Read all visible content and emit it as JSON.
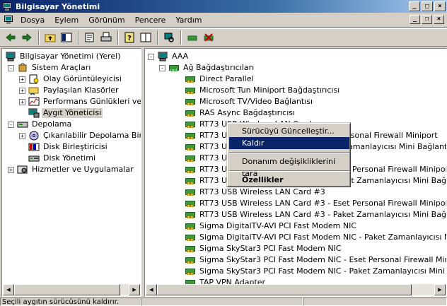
{
  "window": {
    "title": "Bilgisayar Yönetimi"
  },
  "menu": [
    "Dosya",
    "Eylem",
    "Görünüm",
    "Pencere",
    "Yardım"
  ],
  "toolbar_icons": [
    "back-arrow-icon",
    "forward-arrow-icon",
    "up-folder-icon",
    "show-tree-icon",
    "properties-icon",
    "print-icon",
    "help-icon",
    "view-icon",
    "scan-hardware-icon",
    "update-driver-icon",
    "uninstall-icon"
  ],
  "left_tree": [
    {
      "label": "Bilgisayar Yönetimi (Yerel)",
      "level": 0,
      "expander": "",
      "icon": "computer-icon"
    },
    {
      "label": "Sistem Araçları",
      "level": 1,
      "expander": "-",
      "icon": "tools-icon"
    },
    {
      "label": "Olay Görüntüleyicisi",
      "level": 2,
      "expander": "+",
      "icon": "event-viewer-icon"
    },
    {
      "label": "Paylaşılan Klasörler",
      "level": 2,
      "expander": "+",
      "icon": "shared-folder-icon"
    },
    {
      "label": "Performans Günlükleri ve Uy",
      "level": 2,
      "expander": "+",
      "icon": "performance-icon"
    },
    {
      "label": "Aygıt Yöneticisi",
      "level": 2,
      "expander": "",
      "icon": "device-manager-icon",
      "selected": true
    },
    {
      "label": "Depolama",
      "level": 1,
      "expander": "-",
      "icon": "storage-icon"
    },
    {
      "label": "Çıkarılabilir Depolama Birimi",
      "level": 2,
      "expander": "+",
      "icon": "removable-storage-icon"
    },
    {
      "label": "Disk Birleştiricisi",
      "level": 2,
      "expander": "",
      "icon": "defrag-icon"
    },
    {
      "label": "Disk Yönetimi",
      "level": 2,
      "expander": "",
      "icon": "disk-management-icon"
    },
    {
      "label": "Hizmetler ve Uygulamalar",
      "level": 1,
      "expander": "+",
      "icon": "services-icon"
    }
  ],
  "right_tree": {
    "root": "AAA",
    "category": "Ağ Bağdaştırıcıları",
    "devices": [
      "Direct Parallel",
      "Microsoft Tun Miniport Bağdaştırıcısı",
      "Microsoft TV/Video Bağlantısı",
      "RAS Async Bağdaştırıcısı",
      "RT73 USB Wireless LAN Card",
      "RT73 USB Wireless LAN Card - Eset Personal Firewall Miniport",
      "RT73 USB Wireless LAN Card - Paket Zamanlayıcısı Mini Bağlantı Noktası",
      "RT73 USB Wireless LAN Card #2",
      "RT73 USB Wireless LAN Card #2 - Eset Personal Firewall Miniport",
      "RT73 USB Wireless LAN Card #2 - Paket Zamanlayıcısı Mini Bağlantı Noktası",
      "RT73 USB Wireless LAN Card #3",
      "RT73 USB Wireless LAN Card #3 - Eset Personal Firewall Miniport",
      "RT73 USB Wireless LAN Card #3 - Paket Zamanlayıcısı Mini Bağlantı Noktası",
      "Sigma DigitalTV-AVI PCI Fast Modem NIC",
      "Sigma DigitalTV-AVI PCI Fast Modem NIC - Paket Zamanlayıcısı Mini Bağlantı Noktası",
      "Sigma SkyStar3 PCI Fast Modem NIC",
      "Sigma SkyStar3 PCI Fast Modem NIC - Eset Personal Firewall Miniport",
      "Sigma SkyStar3 PCI Fast Modem NIC - Paket Zamanlayıcısı Mini Bağlantı Noktası",
      "TAP VPN Adapter"
    ]
  },
  "context_menu": {
    "items": [
      {
        "label": "Sürücüyü Güncelleştir...",
        "highlighted": false,
        "bold": false
      },
      {
        "label": "Kaldır",
        "highlighted": true,
        "bold": false
      },
      {
        "label": "Donanım değişikliklerini tara",
        "highlighted": false,
        "bold": false
      },
      {
        "label": "Özellikler",
        "highlighted": false,
        "bold": true
      }
    ]
  },
  "status": {
    "text": "Seçili aygıtın sürücüsünü kaldırır."
  }
}
